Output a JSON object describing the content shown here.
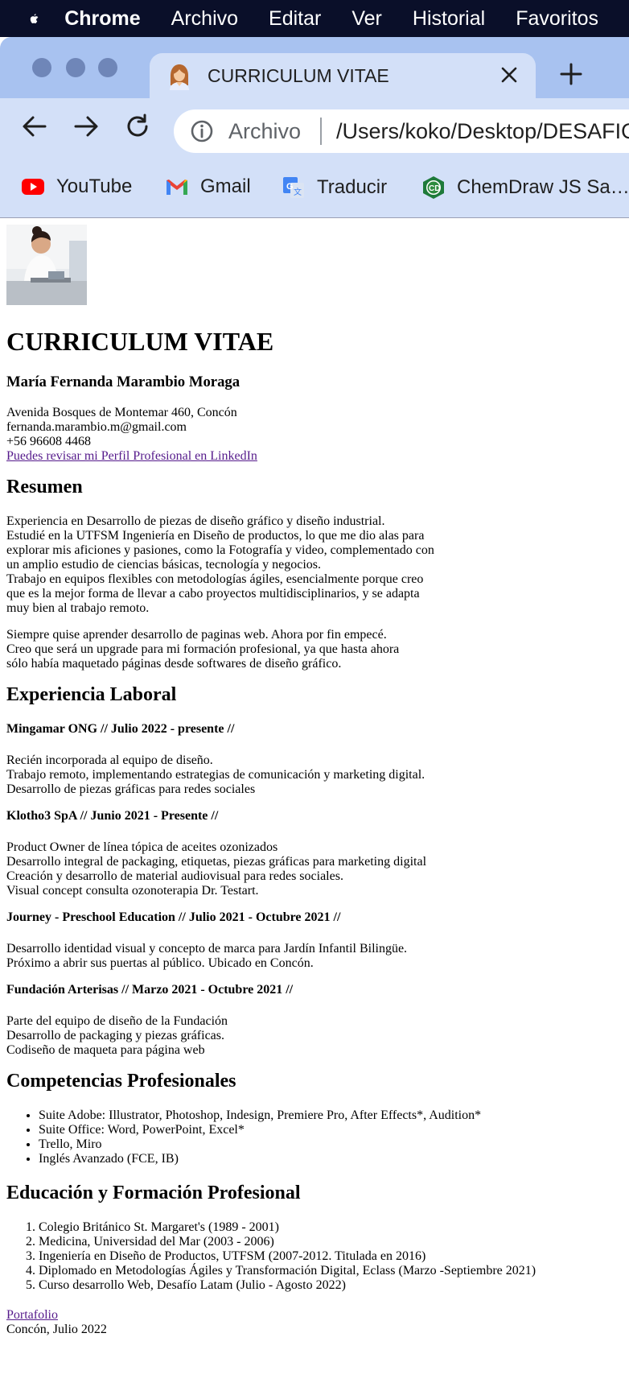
{
  "menubar": {
    "app_name": "Chrome",
    "items": [
      "Archivo",
      "Editar",
      "Ver",
      "Historial",
      "Favoritos"
    ]
  },
  "browser": {
    "tab_title": "CURRICULUM VITAE",
    "address_scheme": "Archivo",
    "address_path": "/Users/koko/Desktop/DESAFIO_LATAM/index.html",
    "bookmarks": [
      {
        "label": "YouTube",
        "icon": "youtube-icon"
      },
      {
        "label": "Gmail",
        "icon": "gmail-icon"
      },
      {
        "label": "Traducir",
        "icon": "translate-icon"
      },
      {
        "label": "ChemDraw JS Sa…",
        "icon": "chemdraw-icon"
      }
    ]
  },
  "cv": {
    "title": "CURRICULUM VITAE",
    "name": "María Fernanda Marambio Moraga",
    "contact": {
      "address": "Avenida Bosques de Montemar 460, Concón",
      "email": "fernanda.marambio.m@gmail.com",
      "phone": "+56 96608 4468",
      "linkedin_text": "Puedes revisar mi Perfil Profesional en LinkedIn"
    },
    "summary": {
      "heading": "Resumen",
      "paragraph1": [
        "Experiencia en Desarrollo de piezas de diseño gráfico y diseño industrial.",
        "Estudié en la UTFSM Ingeniería en Diseño de productos, lo que me dio alas para",
        "explorar mis aficiones y pasiones, como la Fotografía y video, complementado con",
        "un amplio estudio de ciencias básicas, tecnología y negocios.",
        "Trabajo en equipos flexibles con metodologías ágiles, esencialmente porque creo",
        "que es la mejor forma de llevar a cabo proyectos multidisciplinarios, y se adapta",
        "muy bien al trabajo remoto."
      ],
      "paragraph2": [
        "Siempre quise aprender desarrollo de paginas web. Ahora por fin empecé.",
        "Creo que será un upgrade para mi formación profesional, ya que hasta ahora",
        "sólo había maquetado páginas desde softwares de diseño gráfico."
      ]
    },
    "experience": {
      "heading": "Experiencia Laboral",
      "jobs": [
        {
          "title": "Mingamar ONG // Julio 2022 - presente //",
          "lines": [
            "Recién incorporada al equipo de diseño.",
            "Trabajo remoto, implementando estrategias de comunicación y marketing digital.",
            "Desarrollo de piezas gráficas para redes sociales"
          ]
        },
        {
          "title": "Klotho3 SpA // Junio 2021 - Presente //",
          "lines": [
            "Product Owner de línea tópica de aceites ozonizados",
            "Desarrollo integral de packaging, etiquetas, piezas gráficas para marketing digital",
            "Creación y desarrollo de material audiovisual para redes sociales.",
            "Visual concept consulta ozonoterapia Dr. Testart."
          ]
        },
        {
          "title": "Journey - Preschool Education // Julio 2021 - Octubre 2021 //",
          "lines": [
            "Desarrollo identidad visual y concepto de marca para Jardín Infantil Bilingüe.",
            "Próximo a abrir sus puertas al público. Ubicado en Concón."
          ]
        },
        {
          "title": "Fundación Arterisas // Marzo 2021 - Octubre 2021 //",
          "lines": [
            "Parte del equipo de diseño de la Fundación",
            "Desarrollo de packaging y piezas gráficas.",
            "Codiseño de maqueta para página web"
          ]
        }
      ]
    },
    "skills": {
      "heading": "Competencias Profesionales",
      "items": [
        "Suite Adobe: Illustrator, Photoshop, Indesign, Premiere Pro, After Effects*, Audition*",
        "Suite Office: Word, PowerPoint, Excel*",
        "Trello, Miro",
        "Inglés Avanzado (FCE, IB)"
      ]
    },
    "education": {
      "heading": "Educación y Formación Profesional",
      "items": [
        "Colegio Británico St. Margaret's (1989 - 2001)",
        "Medicina, Universidad del Mar (2003 - 2006)",
        "Ingeniería en Diseño de Productos, UTFSM (2007-2012. Titulada en 2016)",
        "Diplomado en Metodologías Ágiles y Transformación Digital, Eclass (Marzo -Septiembre 2021)",
        "Curso desarrollo Web, Desafío Latam (Julio - Agosto 2022)"
      ]
    },
    "footer": {
      "portfolio_link": "Portafolio",
      "place_date": "Concón, Julio 2022"
    }
  }
}
